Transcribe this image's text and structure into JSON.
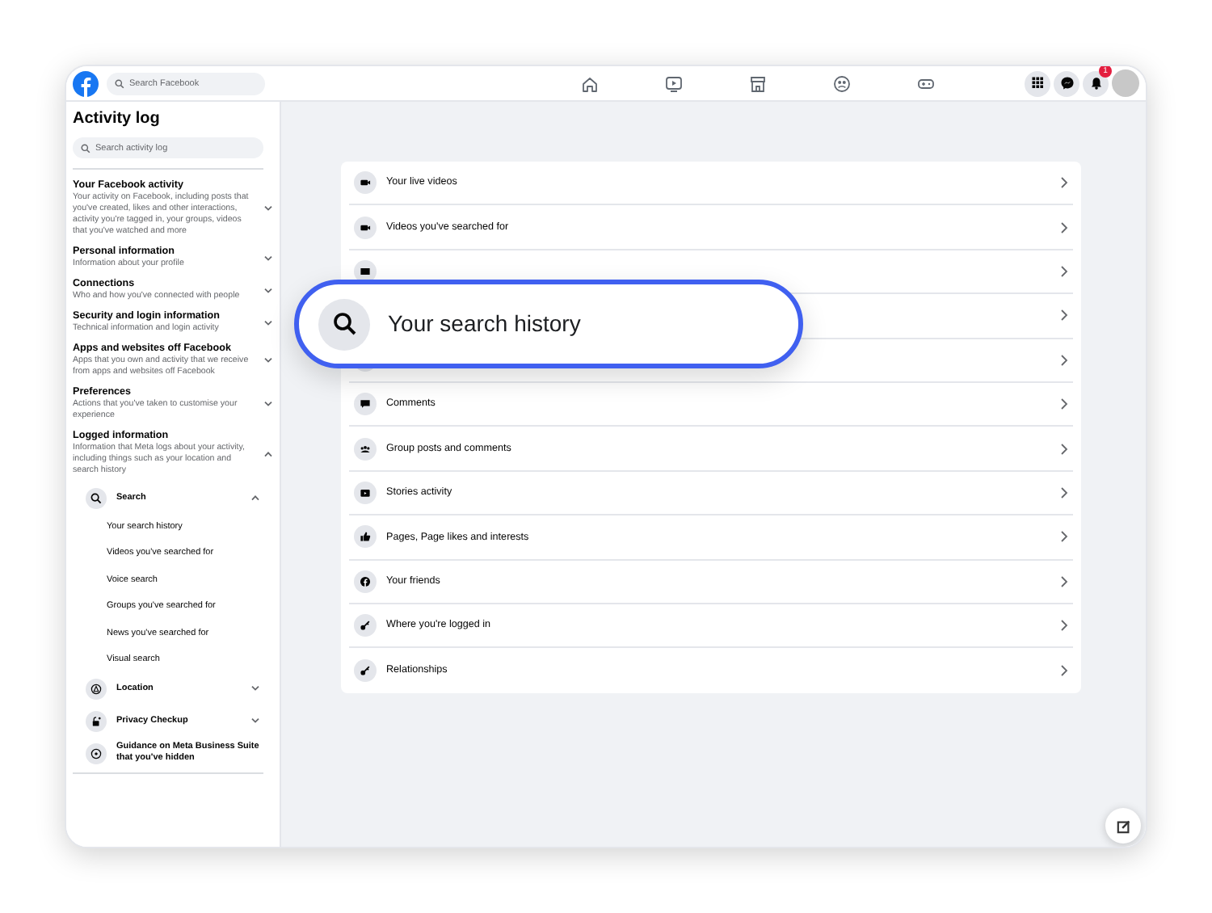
{
  "topbar": {
    "search": {
      "placeholder": "Search Facebook"
    },
    "notifications_badge": "1"
  },
  "sidebar": {
    "title": "Activity log",
    "search": {
      "placeholder": "Search activity log"
    },
    "sections": [
      {
        "title": "Your Facebook activity",
        "description": "Your activity on Facebook, including posts that you've created, likes and other interactions, activity you're tagged in, your groups, videos that you've watched and more",
        "expanded": false
      },
      {
        "title": "Personal information",
        "description": "Information about your profile",
        "expanded": false
      },
      {
        "title": "Connections",
        "description": "Who and how you've connected with people",
        "expanded": false
      },
      {
        "title": "Security and login information",
        "description": "Technical information and login activity",
        "expanded": false
      },
      {
        "title": "Apps and websites off Facebook",
        "description": "Apps that you own and activity that we receive from apps and websites off Facebook",
        "expanded": false
      },
      {
        "title": "Preferences",
        "description": "Actions that you've taken to customise your experience",
        "expanded": false
      },
      {
        "title": "Logged information",
        "description": "Information that Meta logs about your activity, including things such as your location and search history",
        "expanded": true,
        "children": [
          {
            "label": "Search",
            "expanded": true,
            "children": [
              {
                "label": "Your search history"
              },
              {
                "label": "Videos you've searched for"
              },
              {
                "label": "Voice search"
              },
              {
                "label": "Groups you've searched for"
              },
              {
                "label": "News you've searched for"
              },
              {
                "label": "Visual search"
              }
            ]
          },
          {
            "label": "Location",
            "expanded": false
          },
          {
            "label": "Privacy Checkup",
            "expanded": false
          },
          {
            "label": "Guidance on Meta Business Suite that you've hidden"
          }
        ]
      }
    ]
  },
  "main": {
    "rows": [
      {
        "label": "Your live videos"
      },
      {
        "label": "Videos you've searched for"
      },
      {},
      {},
      {},
      {
        "label": "Comments"
      },
      {
        "label": "Group posts and comments"
      },
      {
        "label": "Stories activity"
      },
      {
        "label": "Pages, Page likes and interests"
      },
      {
        "label": "Your friends"
      },
      {
        "label": "Where you're logged in"
      },
      {
        "label": "Relationships"
      }
    ]
  },
  "callout": {
    "label": "Your search history"
  }
}
